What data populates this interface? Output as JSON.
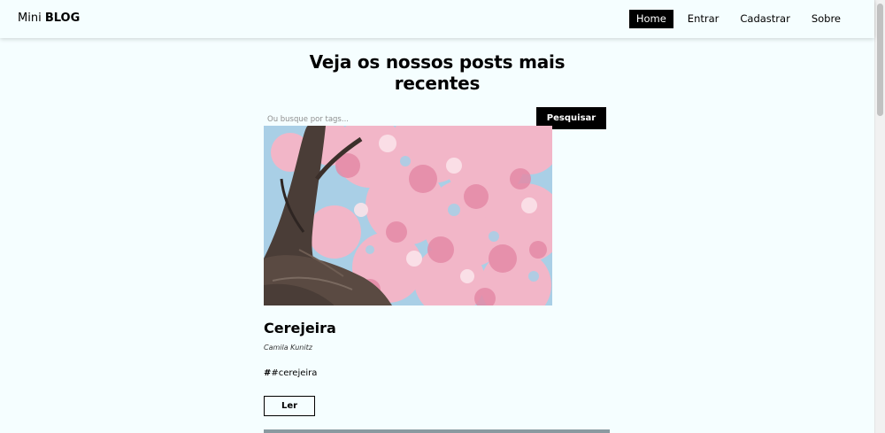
{
  "brand": {
    "prefix": "Mini ",
    "bold": "BLOG"
  },
  "nav": {
    "items": [
      {
        "label": "Home",
        "active": true
      },
      {
        "label": "Entrar",
        "active": false
      },
      {
        "label": "Cadastrar",
        "active": false
      },
      {
        "label": "Sobre",
        "active": false
      }
    ]
  },
  "main": {
    "title": "Veja os nossos posts mais recentes",
    "search": {
      "placeholder": "Ou busque por tags...",
      "value": "",
      "button_label": "Pesquisar"
    }
  },
  "posts": [
    {
      "title": "Cerejeira",
      "author": "Camila Kunitz",
      "tags": [
        {
          "hash": "#",
          "label": "#cerejeira"
        }
      ],
      "read_label": "Ler"
    }
  ],
  "colors": {
    "background": "#f5feff",
    "primary": "#000000",
    "blossom": "#f2b6c8",
    "sky": "#a9cfe6"
  }
}
